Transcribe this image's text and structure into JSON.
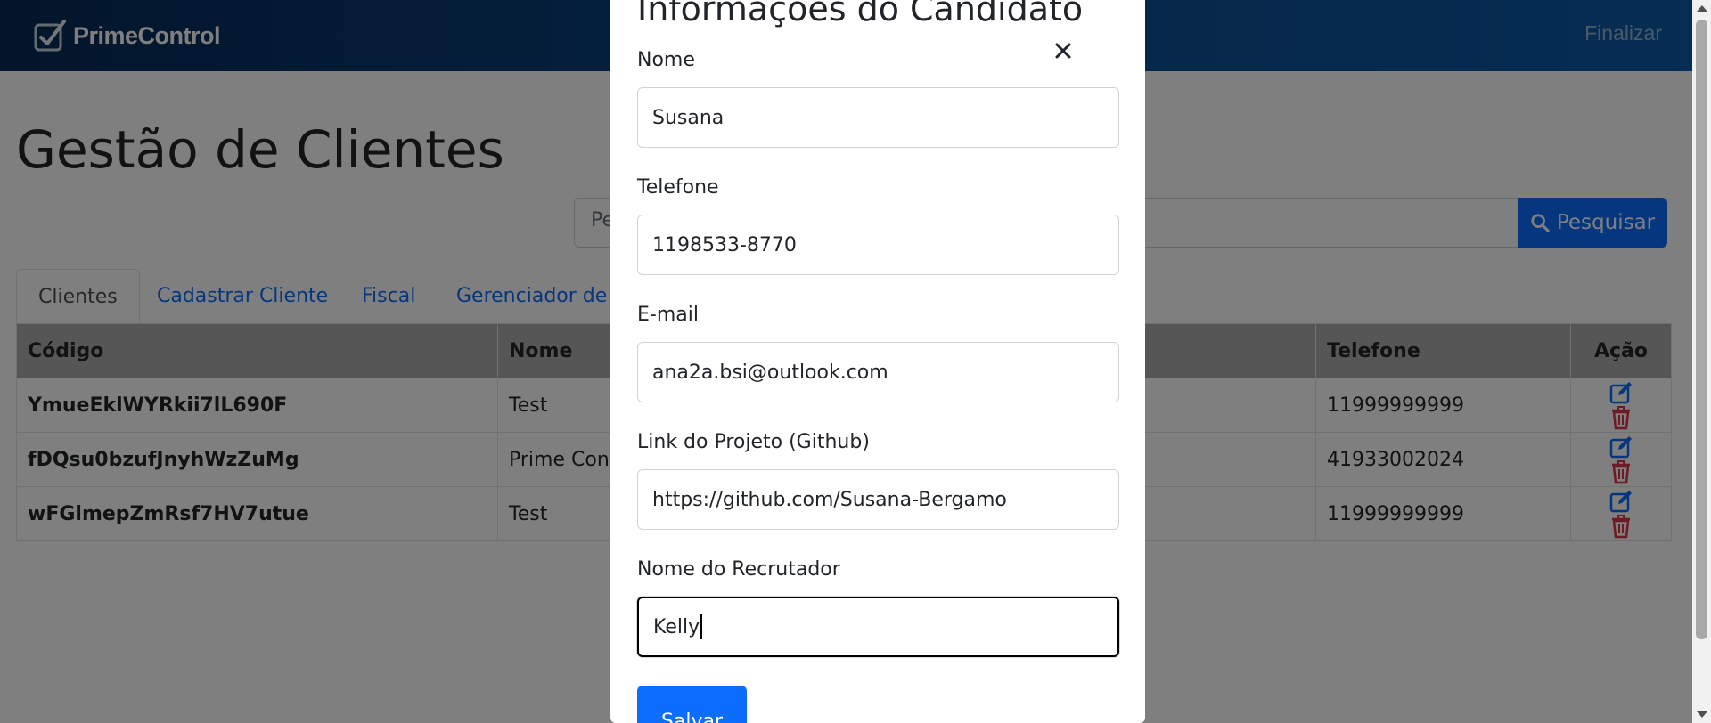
{
  "navbar": {
    "brand": "PrimeControl",
    "right_link": "Finalizar"
  },
  "page": {
    "title": "Gestão de Clientes",
    "search_placeholder": "Pe",
    "search_button": "Pesquisar"
  },
  "tabs": [
    "Clientes",
    "Cadastrar Cliente",
    "Fiscal",
    "Gerenciador de ..."
  ],
  "table": {
    "headers": {
      "codigo": "Código",
      "nome": "Nome",
      "telefone": "Telefone",
      "acao": "Ação"
    },
    "rows": [
      {
        "codigo": "YmueEklWYRkii7lL690F",
        "nome": "Test",
        "telefone": "11999999999"
      },
      {
        "codigo": "fDQsu0bzufJnyhWzZuMg",
        "nome": "Prime Cont",
        "telefone": "41933002024"
      },
      {
        "codigo": "wFGlmepZmRsf7HV7utue",
        "nome": "Test",
        "telefone": "11999999999"
      }
    ]
  },
  "modal": {
    "title": "Informações do Candidato",
    "fields": [
      {
        "label": "Nome",
        "value": "Susana"
      },
      {
        "label": "Telefone",
        "value": "1198533-8770"
      },
      {
        "label": "E-mail",
        "value": "ana2a.bsi@outlook.com"
      },
      {
        "label": "Link do Projeto (Github)",
        "value": "https://github.com/Susana-Bergamo"
      },
      {
        "label": "Nome do Recrutador",
        "value": "Kelly"
      }
    ],
    "save_button": "Salvar"
  },
  "icons": {
    "edit": "edit-icon",
    "delete": "trash-icon",
    "search": "search-icon",
    "close": "close-icon",
    "logo": "checkbox-logo-icon"
  },
  "colors": {
    "primary": "#0d6efd",
    "danger": "#dc3545",
    "navbar": "#0a4a8c"
  }
}
